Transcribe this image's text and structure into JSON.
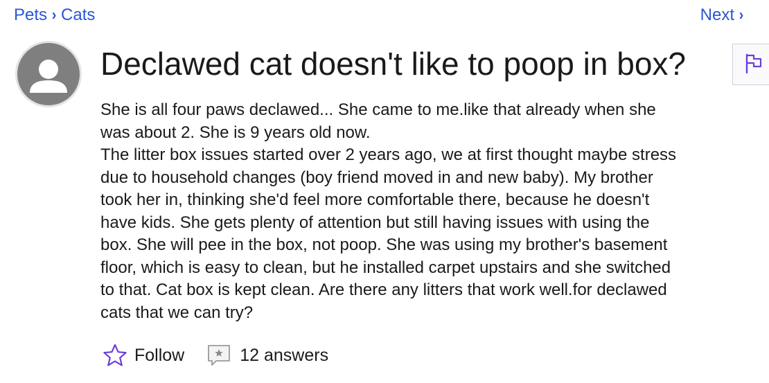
{
  "breadcrumb": {
    "items": [
      {
        "label": "Pets"
      },
      {
        "label": "Cats"
      }
    ]
  },
  "nav": {
    "next_label": "Next"
  },
  "question": {
    "title": "Declawed cat doesn't like to poop in box?",
    "body_lines": [
      "She is all four paws declawed... She came to me.like that already when she",
      "was about 2. She is 9 years old now.",
      "The litter box issues started over 2 years ago, we at first thought maybe stress",
      "due to household changes (boy friend moved in and new baby). My brother",
      "took her in, thinking she'd feel more comfortable there, because he doesn't",
      "have kids. She gets plenty of attention but still having issues with using the",
      "box. She will pee in the box, not poop. She was using my brother's basement",
      "floor, which is easy to clean, but he installed carpet upstairs and she switched",
      "to that. Cat box is kept clean. Are there any litters that work well.for declawed",
      "cats that we can try?"
    ]
  },
  "actions": {
    "follow_label": "Follow",
    "answers_label": "12 answers"
  },
  "icons": {
    "avatar": "default-user-avatar",
    "flag": "flag-icon",
    "follow": "star-outline-icon",
    "answers": "comment-star-icon",
    "chevron": "chevron-right-icon"
  },
  "colors": {
    "link": "#2b56d6",
    "accent_purple": "#6a3fd6",
    "avatar_bg": "#7f7f7f"
  }
}
